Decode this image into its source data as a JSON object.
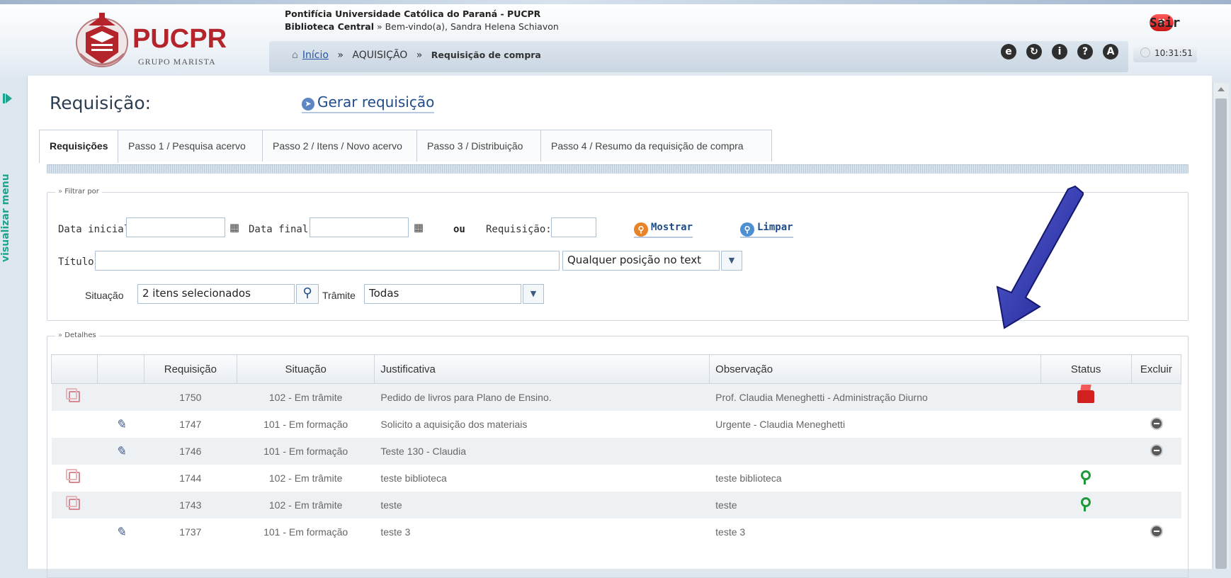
{
  "header": {
    "institution": "Pontifícia Universidade Católica do Paraná - PUCPR",
    "library": "Biblioteca Central",
    "welcome": "» Bem-vindo(a), Sandra Helena Schiavon",
    "logo_name": "PUCPR",
    "logo_sub": "GRUPO MARISTA",
    "sair_label": "Sair",
    "clock": "10:31:51",
    "breadcrumb": {
      "home": "Início",
      "sep1": "»",
      "section": "AQUISIÇÃO",
      "sep2": "»",
      "current": "Requisição de compra"
    },
    "toolbar_icons": [
      "browser-icon",
      "refresh-icon",
      "info-icon",
      "help-icon",
      "user-icon"
    ]
  },
  "sidebar": {
    "toggle_label": "visualizar menu"
  },
  "page": {
    "title": "Requisição:",
    "gerar_label": "Gerar requisição"
  },
  "tabs": [
    {
      "label": "Requisições",
      "active": true
    },
    {
      "label": "Passo 1 / Pesquisa acervo"
    },
    {
      "label": "Passo 2 / Itens / Novo acervo"
    },
    {
      "label": "Passo 3 / Distribuição"
    },
    {
      "label": "Passo 4 / Resumo da requisição de compra"
    }
  ],
  "filter": {
    "legend": "Filtrar por",
    "data_inicial_label": "Data inicial:",
    "data_inicial_value": "",
    "data_final_label": "Data final:",
    "data_final_value": "",
    "ou": "ou",
    "requisicao_label": "Requisição:",
    "requisicao_value": "",
    "mostrar_label": "Mostrar",
    "limpar_label": "Limpar",
    "titulo_label": "Título:",
    "titulo_value": "",
    "posicao_value": "Qualquer posição no text",
    "situacao_label": "Situação",
    "situacao_value": "2 itens selecionados",
    "tramite_label": "Trâmite",
    "tramite_value": "Todas"
  },
  "details": {
    "legend": "Detalhes",
    "columns": [
      "",
      "",
      "Requisição",
      "Situação",
      "Justificativa",
      "Observação",
      "Status",
      "Excluir"
    ],
    "rows": [
      {
        "copy": true,
        "edit": false,
        "num": "1750",
        "sit": "102 - Em trâmite",
        "just": "Pedido de livros para Plano de Ensino.",
        "obs": "Prof. Claudia Meneghetti - Administração Diurno",
        "status": "red",
        "del": false
      },
      {
        "copy": false,
        "edit": true,
        "num": "1747",
        "sit": "101 - Em formação",
        "just": "Solicito a aquisição dos materiais",
        "obs": "Urgente - Claudia Meneghetti",
        "status": "",
        "del": true
      },
      {
        "copy": false,
        "edit": true,
        "num": "1746",
        "sit": "101 - Em formação",
        "just": "Teste 130 - Claudia",
        "obs": "",
        "status": "",
        "del": true
      },
      {
        "copy": true,
        "edit": false,
        "num": "1744",
        "sit": "102 - Em trâmite",
        "just": "teste biblioteca",
        "obs": "teste biblioteca",
        "status": "green",
        "del": false
      },
      {
        "copy": true,
        "edit": false,
        "num": "1743",
        "sit": "102 - Em trâmite",
        "just": "teste",
        "obs": "teste",
        "status": "green",
        "del": false
      },
      {
        "copy": false,
        "edit": true,
        "num": "1737",
        "sit": "101 - Em formação",
        "just": "teste 3",
        "obs": "teste 3",
        "status": "",
        "del": true
      }
    ]
  },
  "colors": {
    "accent": "#1f4c8a",
    "menu_green": "#1aa58c",
    "brand_red": "#b3242b",
    "annotation_arrow": "#2a2fa6"
  }
}
